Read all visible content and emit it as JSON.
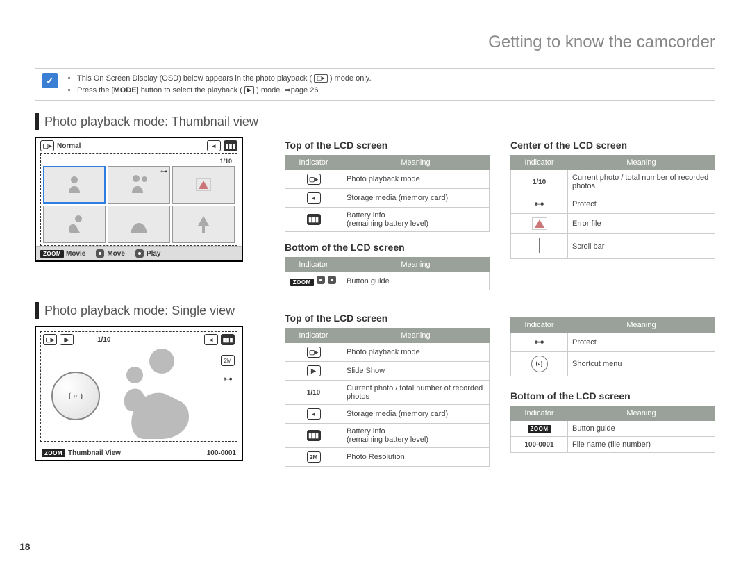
{
  "page_title": "Getting to know the camcorder",
  "page_number": "18",
  "note": {
    "line1_a": "This On Screen Display (OSD) below appears in the photo playback (",
    "line1_b": ") mode only.",
    "line2_a": "Press the [",
    "line2_mode": "MODE",
    "line2_b": "] button to select the playback (",
    "line2_c": ") mode. ➥page 26"
  },
  "sec1": "Photo playback mode: Thumbnail view",
  "sec2": "Photo playback mode: Single view",
  "tables": {
    "hdr_ind": "Indicator",
    "hdr_mean": "Meaning",
    "top_h": "Top of the LCD screen",
    "center_h": "Center of the LCD screen",
    "bottom_h": "Bottom of the LCD screen",
    "t1": [
      {
        "m": "Photo playback mode"
      },
      {
        "m": "Storage media (memory card)"
      },
      {
        "m": "Battery info\n(remaining battery level)"
      }
    ],
    "b1": [
      {
        "m": "Button guide"
      }
    ],
    "c1": [
      {
        "i": "1/10",
        "m": "Current photo / total number of recorded photos"
      },
      {
        "m": "Protect"
      },
      {
        "m": "Error file"
      },
      {
        "m": "Scroll bar"
      }
    ],
    "t2": [
      {
        "m": "Photo playback mode"
      },
      {
        "m": "Slide Show"
      },
      {
        "i": "1/10",
        "m": "Current photo / total number of recorded photos"
      },
      {
        "m": "Storage media (memory card)"
      },
      {
        "m": "Battery info\n(remaining battery level)"
      },
      {
        "m": "Photo Resolution"
      }
    ],
    "t2r": [
      {
        "m": "Protect"
      },
      {
        "m": "Shortcut menu"
      }
    ],
    "b2": [
      {
        "m": "Button guide"
      },
      {
        "i": "100-0001",
        "m": "File name (file number)"
      }
    ]
  },
  "lcd1": {
    "normal": "Normal",
    "count": "1/10",
    "footer_movie": "Movie",
    "footer_move": "Move",
    "footer_play": "Play",
    "zoom": "ZOOM"
  },
  "lcd2": {
    "count": "1/10",
    "thumb_view": "Thumbnail View",
    "file": "100-0001",
    "zoom": "ZOOM"
  }
}
